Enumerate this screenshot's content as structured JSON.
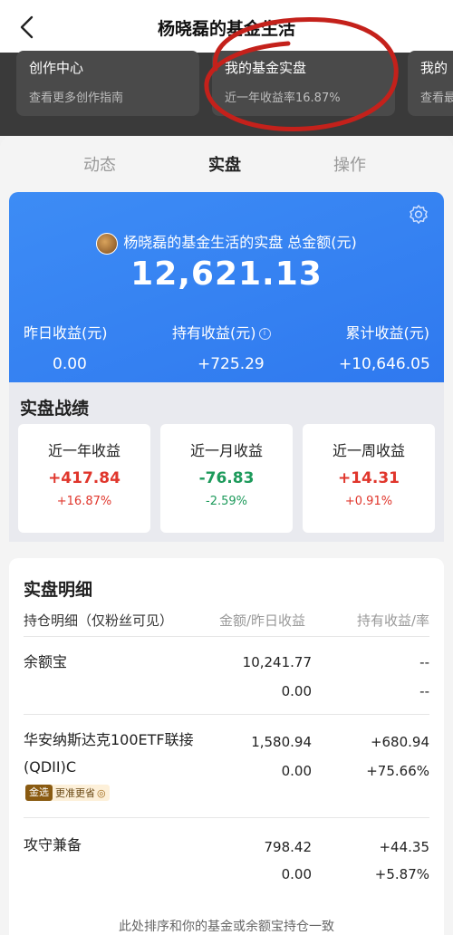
{
  "nav": {
    "title": "杨晓磊的基金生活"
  },
  "top_cards": [
    {
      "title": "创作中心",
      "subtitle": "查看更多创作指南"
    },
    {
      "title": "我的基金实盘",
      "subtitle": "近一年收益率16.87%"
    },
    {
      "title": "我的",
      "subtitle": "查看最"
    }
  ],
  "tabs": [
    "动态",
    "实盘",
    "操作"
  ],
  "hero": {
    "title": "杨晓磊的基金生活的实盘 总金额(元)",
    "total": "12,621.13",
    "stats": [
      {
        "label": "昨日收益(元)",
        "value": "0.00"
      },
      {
        "label": "持有收益(元)",
        "value": "+725.29"
      },
      {
        "label": "累计收益(元)",
        "value": "+10,646.05"
      }
    ]
  },
  "performance": {
    "title": "实盘战绩",
    "cards": [
      {
        "label": "近一年收益",
        "value": "+417.84",
        "pct": "+16.87%"
      },
      {
        "label": "近一月收益",
        "value": "-76.83",
        "pct": "-2.59%"
      },
      {
        "label": "近一周收益",
        "value": "+14.31",
        "pct": "+0.91%"
      }
    ]
  },
  "detail": {
    "title": "实盘明细",
    "headers": [
      "持仓明细（仅粉丝可见）",
      "金额/昨日收益",
      "持有收益/率"
    ],
    "rows": [
      {
        "name": "余额宝",
        "amount": "10,241.77",
        "daily": "0.00",
        "hold": "--",
        "rate": "--"
      },
      {
        "name_line1": "华安纳斯达克100ETF联接",
        "name_line2": "(QDII)C",
        "amount": "1,580.94",
        "daily": "0.00",
        "hold": "+680.94",
        "rate": "+75.66%",
        "badge_key": "金选",
        "badge_text": "更准更省"
      },
      {
        "name": "攻守兼备",
        "amount": "798.42",
        "daily": "0.00",
        "hold": "+44.35",
        "rate": "+5.87%"
      }
    ]
  },
  "footer": "此处排序和你的基金或余额宝持仓一致"
}
